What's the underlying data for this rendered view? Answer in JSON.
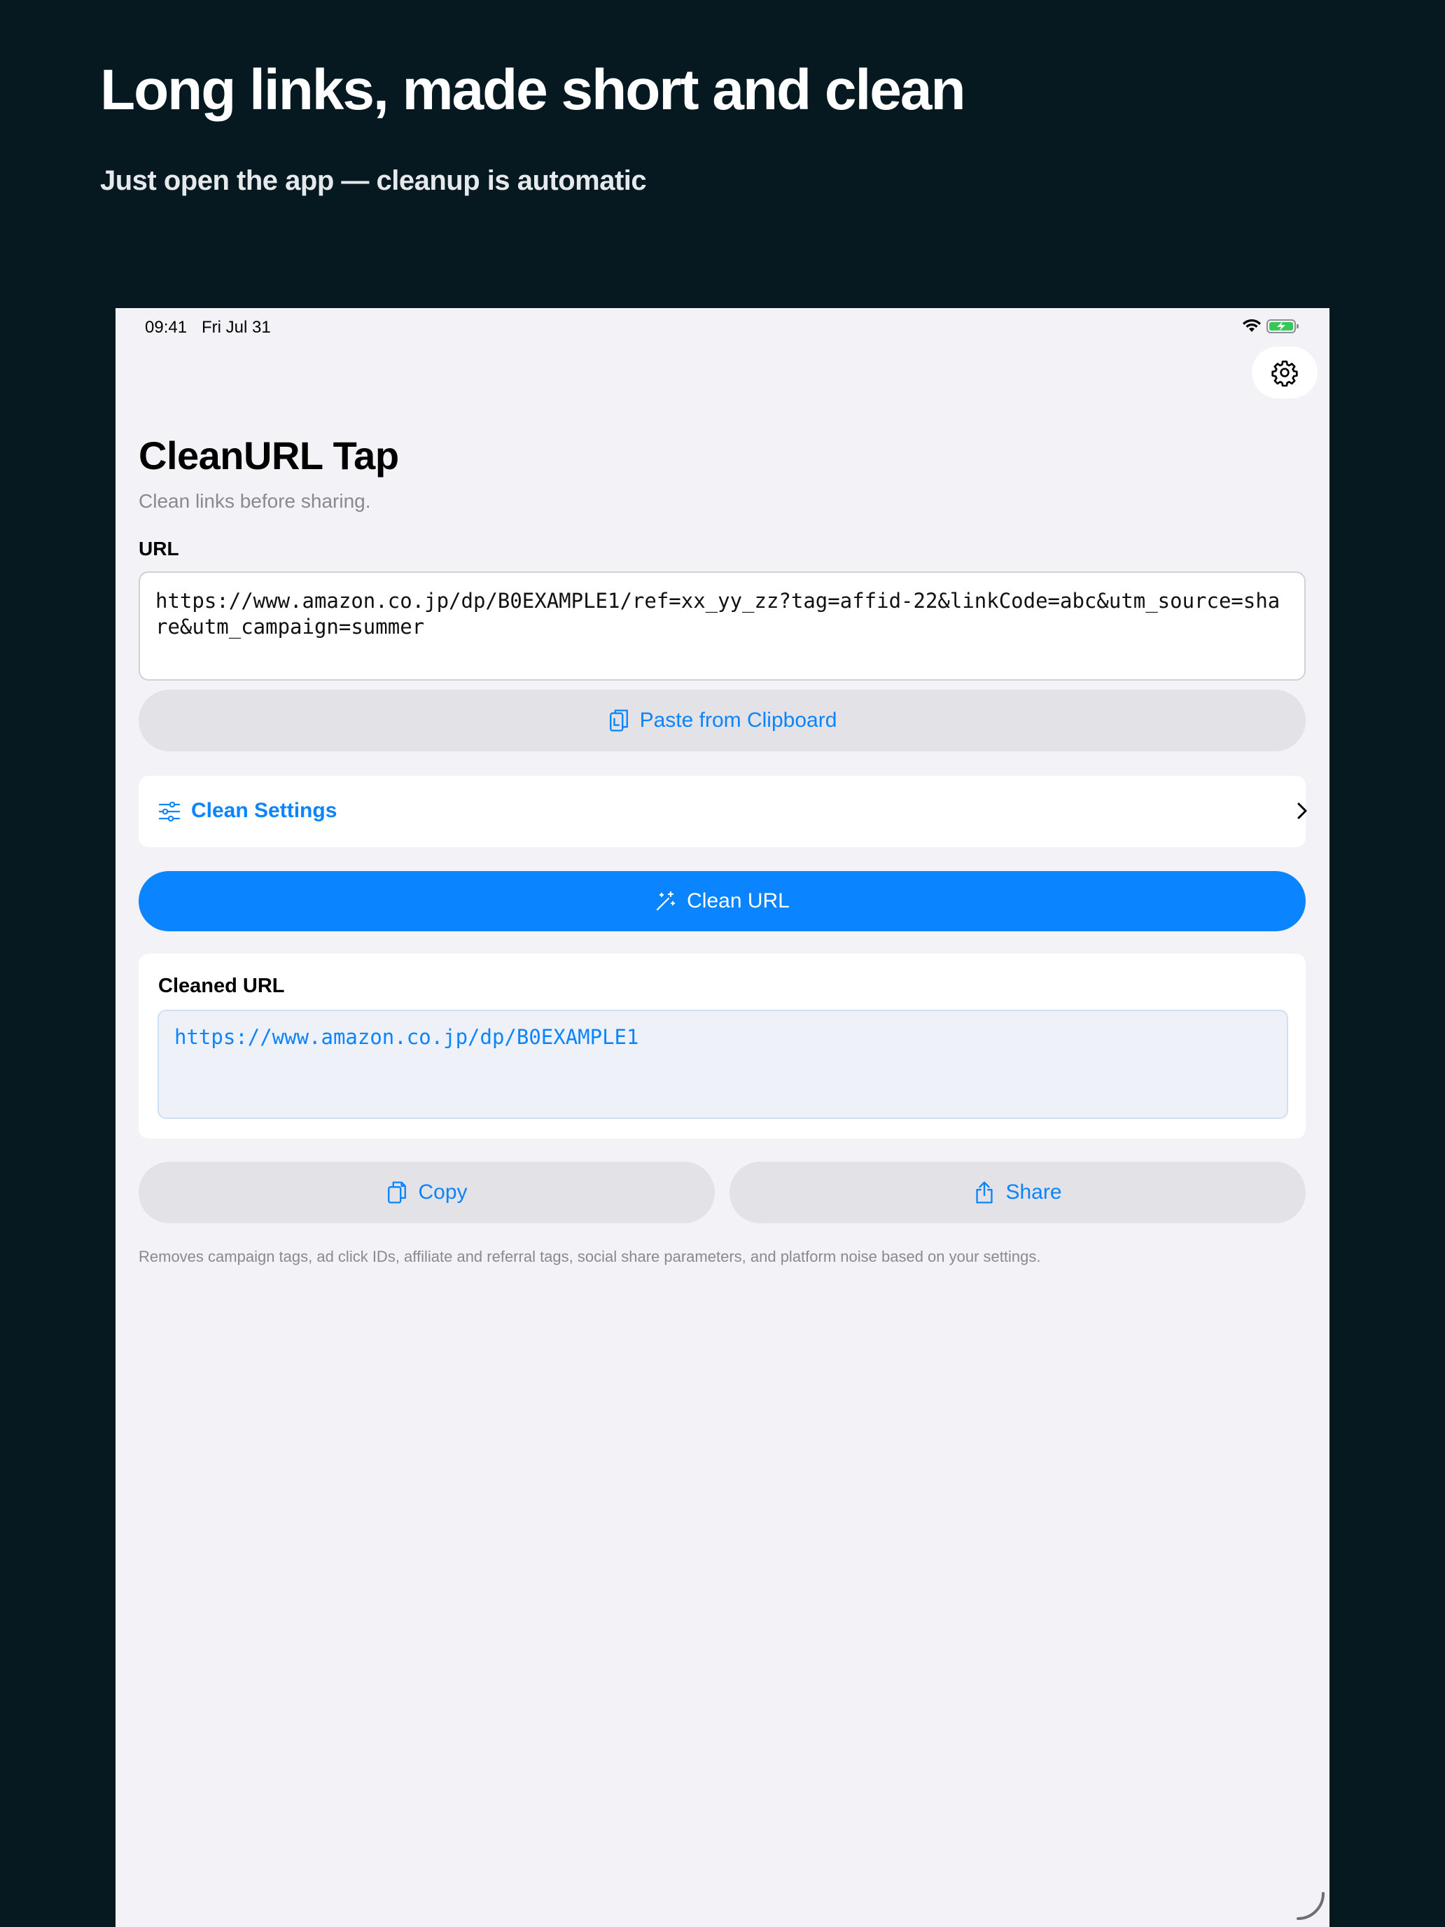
{
  "marketing": {
    "headline": "Long links, made short and clean",
    "subheadline": "Just open the app — cleanup is automatic"
  },
  "status_bar": {
    "time": "09:41",
    "date": "Fri Jul 31",
    "icons": [
      "wifi-icon",
      "battery-charging-icon"
    ]
  },
  "header": {
    "settings_icon": "gear-icon",
    "title": "CleanURL Tap",
    "subtitle": "Clean links before sharing."
  },
  "input": {
    "label": "URL",
    "value": "https://www.amazon.co.jp/dp/B0EXAMPLE1/ref=xx_yy_zz?tag=affid-22&linkCode=abc&utm_source=share&utm_campaign=summer"
  },
  "actions": {
    "paste_label": "Paste from Clipboard",
    "paste_icon": "clipboard-icon",
    "settings_label": "Clean Settings",
    "settings_icon": "sliders-icon",
    "clean_label": "Clean URL",
    "clean_icon": "magic-wand-icon",
    "copy_label": "Copy",
    "copy_icon": "copy-icon",
    "share_label": "Share",
    "share_icon": "share-icon"
  },
  "result": {
    "label": "Cleaned URL",
    "value": "https://www.amazon.co.jp/dp/B0EXAMPLE1"
  },
  "footnote": "Removes campaign tags, ad click IDs, affiliate and referral tags, social share parameters, and platform noise based on your settings.",
  "colors": {
    "background": "#061820",
    "screen": "#f2f2f7",
    "accent": "#0a84ff",
    "secondary_button": "#e2e2e7",
    "muted_text": "#8a8a8e"
  }
}
